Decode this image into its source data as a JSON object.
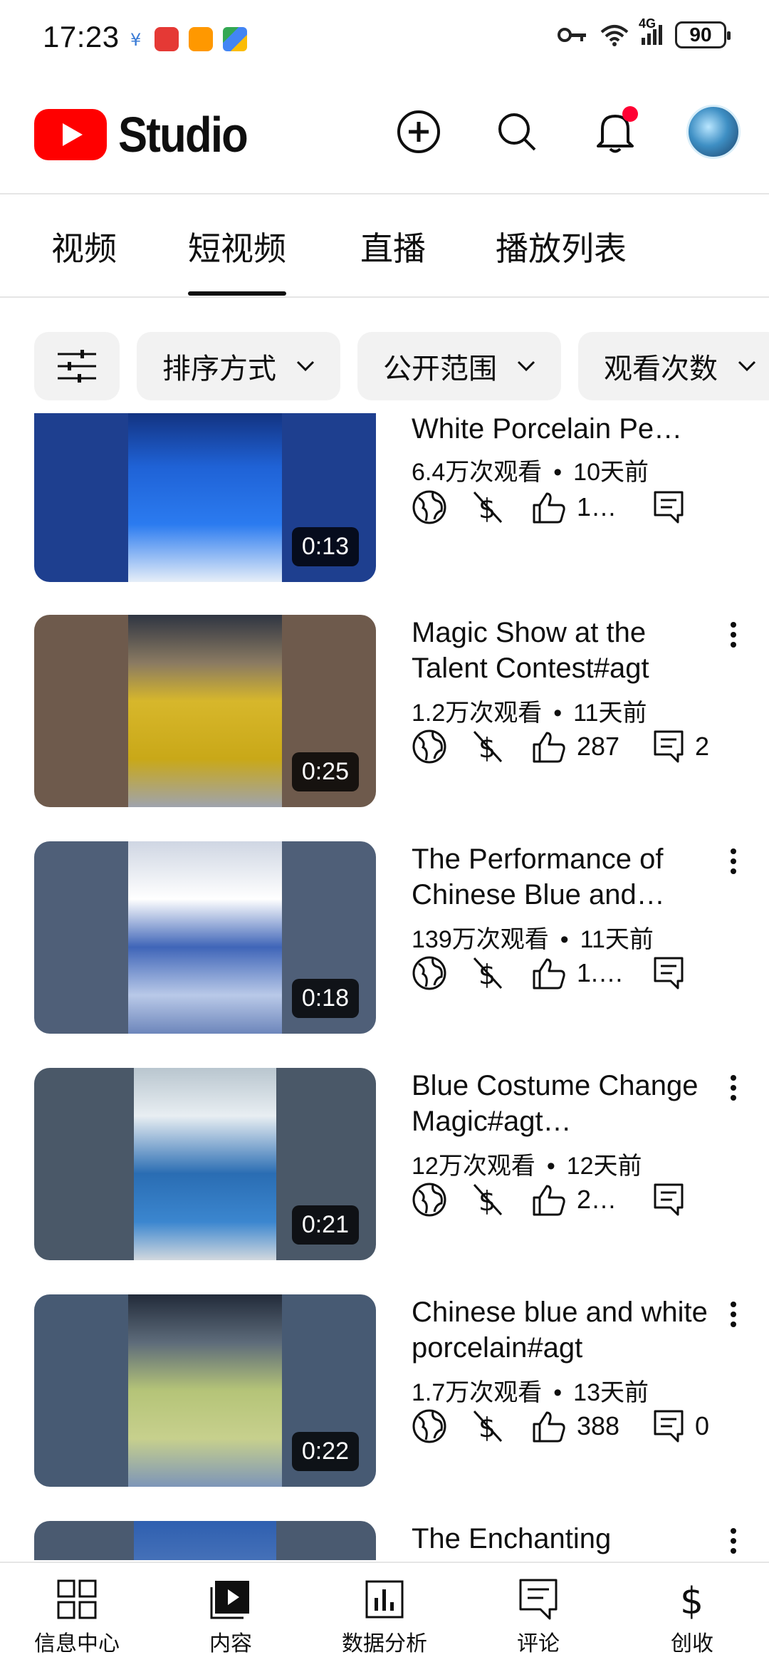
{
  "status_bar": {
    "time": "17:23",
    "network": "4G",
    "battery": "90"
  },
  "app": {
    "logo_text": "Studio"
  },
  "tabs": [
    {
      "label": "视频"
    },
    {
      "label": "短视频"
    },
    {
      "label": "直播"
    },
    {
      "label": "播放列表"
    }
  ],
  "active_tab": "短视频",
  "filters": [
    {
      "label": "排序方式"
    },
    {
      "label": "公开范围"
    },
    {
      "label": "观看次数"
    }
  ],
  "videos": [
    {
      "title": "White Porcelain Pe…",
      "views": "6.4万次观看",
      "age": "10天前",
      "likes": "1…",
      "comments": "",
      "duration": "0:13"
    },
    {
      "title": "Magic Show at the Talent Contest#agt",
      "views": "1.2万次观看",
      "age": "11天前",
      "likes": "287",
      "comments": "2",
      "duration": "0:25"
    },
    {
      "title": "The Performance of Chinese Blue and…",
      "views": "139万次观看",
      "age": "11天前",
      "likes": "1.…",
      "comments": "",
      "duration": "0:18"
    },
    {
      "title": "Blue Costume Change Magic#agt…",
      "views": "12万次观看",
      "age": "12天前",
      "likes": "2…",
      "comments": "",
      "duration": "0:21"
    },
    {
      "title": "Chinese blue and white porcelain#agt",
      "views": "1.7万次观看",
      "age": "13天前",
      "likes": "388",
      "comments": "0",
      "duration": "0:22"
    },
    {
      "title": "The Enchanting",
      "views": "",
      "age": "",
      "likes": "",
      "comments": "",
      "duration": ""
    }
  ],
  "bottom_nav": [
    {
      "label": "信息中心",
      "icon": "dashboard-icon"
    },
    {
      "label": "内容",
      "icon": "content-icon"
    },
    {
      "label": "数据分析",
      "icon": "analytics-icon"
    },
    {
      "label": "评论",
      "icon": "comments-icon"
    },
    {
      "label": "创收",
      "icon": "earn-icon"
    }
  ],
  "colors": {
    "brand_red": "#ff0000",
    "notification_dot": "#ff0033",
    "chip_bg": "#f2f2f2"
  }
}
